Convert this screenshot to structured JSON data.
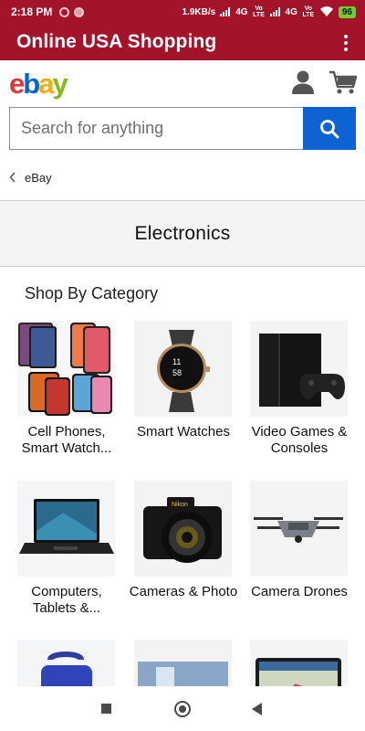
{
  "status_bar": {
    "time": "2:18 PM",
    "network_speed": "1.9KB/s",
    "network_type_1": "4G",
    "network_type_2": "4G",
    "volte_label": "Vo LTE",
    "battery": "96"
  },
  "app_bar": {
    "title": "Online USA Shopping"
  },
  "header": {
    "logo": {
      "e": "e",
      "b": "b",
      "a": "a",
      "y": "y"
    }
  },
  "search": {
    "placeholder": "Search for anything"
  },
  "breadcrumb": {
    "label": "eBay"
  },
  "category": {
    "title": "Electronics"
  },
  "section": {
    "title": "Shop By Category"
  },
  "tiles": [
    {
      "label": "Cell Phones, Smart Watch..."
    },
    {
      "label": "Smart Watches"
    },
    {
      "label": "Video Games & Consoles"
    },
    {
      "label": "Computers, Tablets &..."
    },
    {
      "label": "Cameras & Photo"
    },
    {
      "label": "Camera Drones"
    },
    {
      "label": ""
    },
    {
      "label": ""
    },
    {
      "label": ""
    }
  ],
  "colors": {
    "app_bar": "#a3142a",
    "search_button": "#0d63d3",
    "ebay_red": "#e53238",
    "ebay_blue": "#0064d2",
    "ebay_yellow": "#f5af02",
    "ebay_green": "#86b817"
  }
}
